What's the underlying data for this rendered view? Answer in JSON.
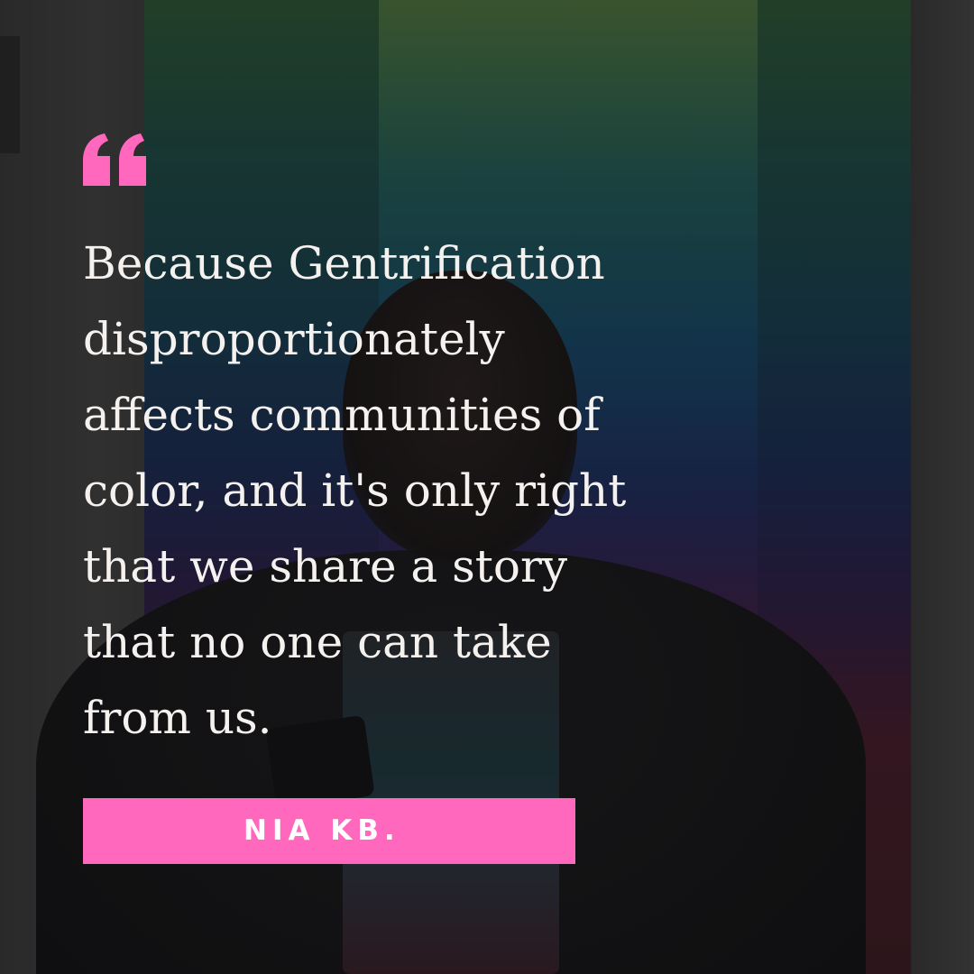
{
  "quote": {
    "icon": "quote-mark-icon",
    "text": "Because Gentrification disproportionately affects communities of color, and it's only right that we share a story that no one can take from us.",
    "lines": [
      "Because Gentrification",
      "disproportionately",
      "affects communities of",
      "color, and it's only right",
      "that we share a story",
      "that no one can take",
      "from us."
    ]
  },
  "author": {
    "name": "NIA KB."
  },
  "colors": {
    "accent": "#ff68bd",
    "text": "#f4f1ee"
  }
}
